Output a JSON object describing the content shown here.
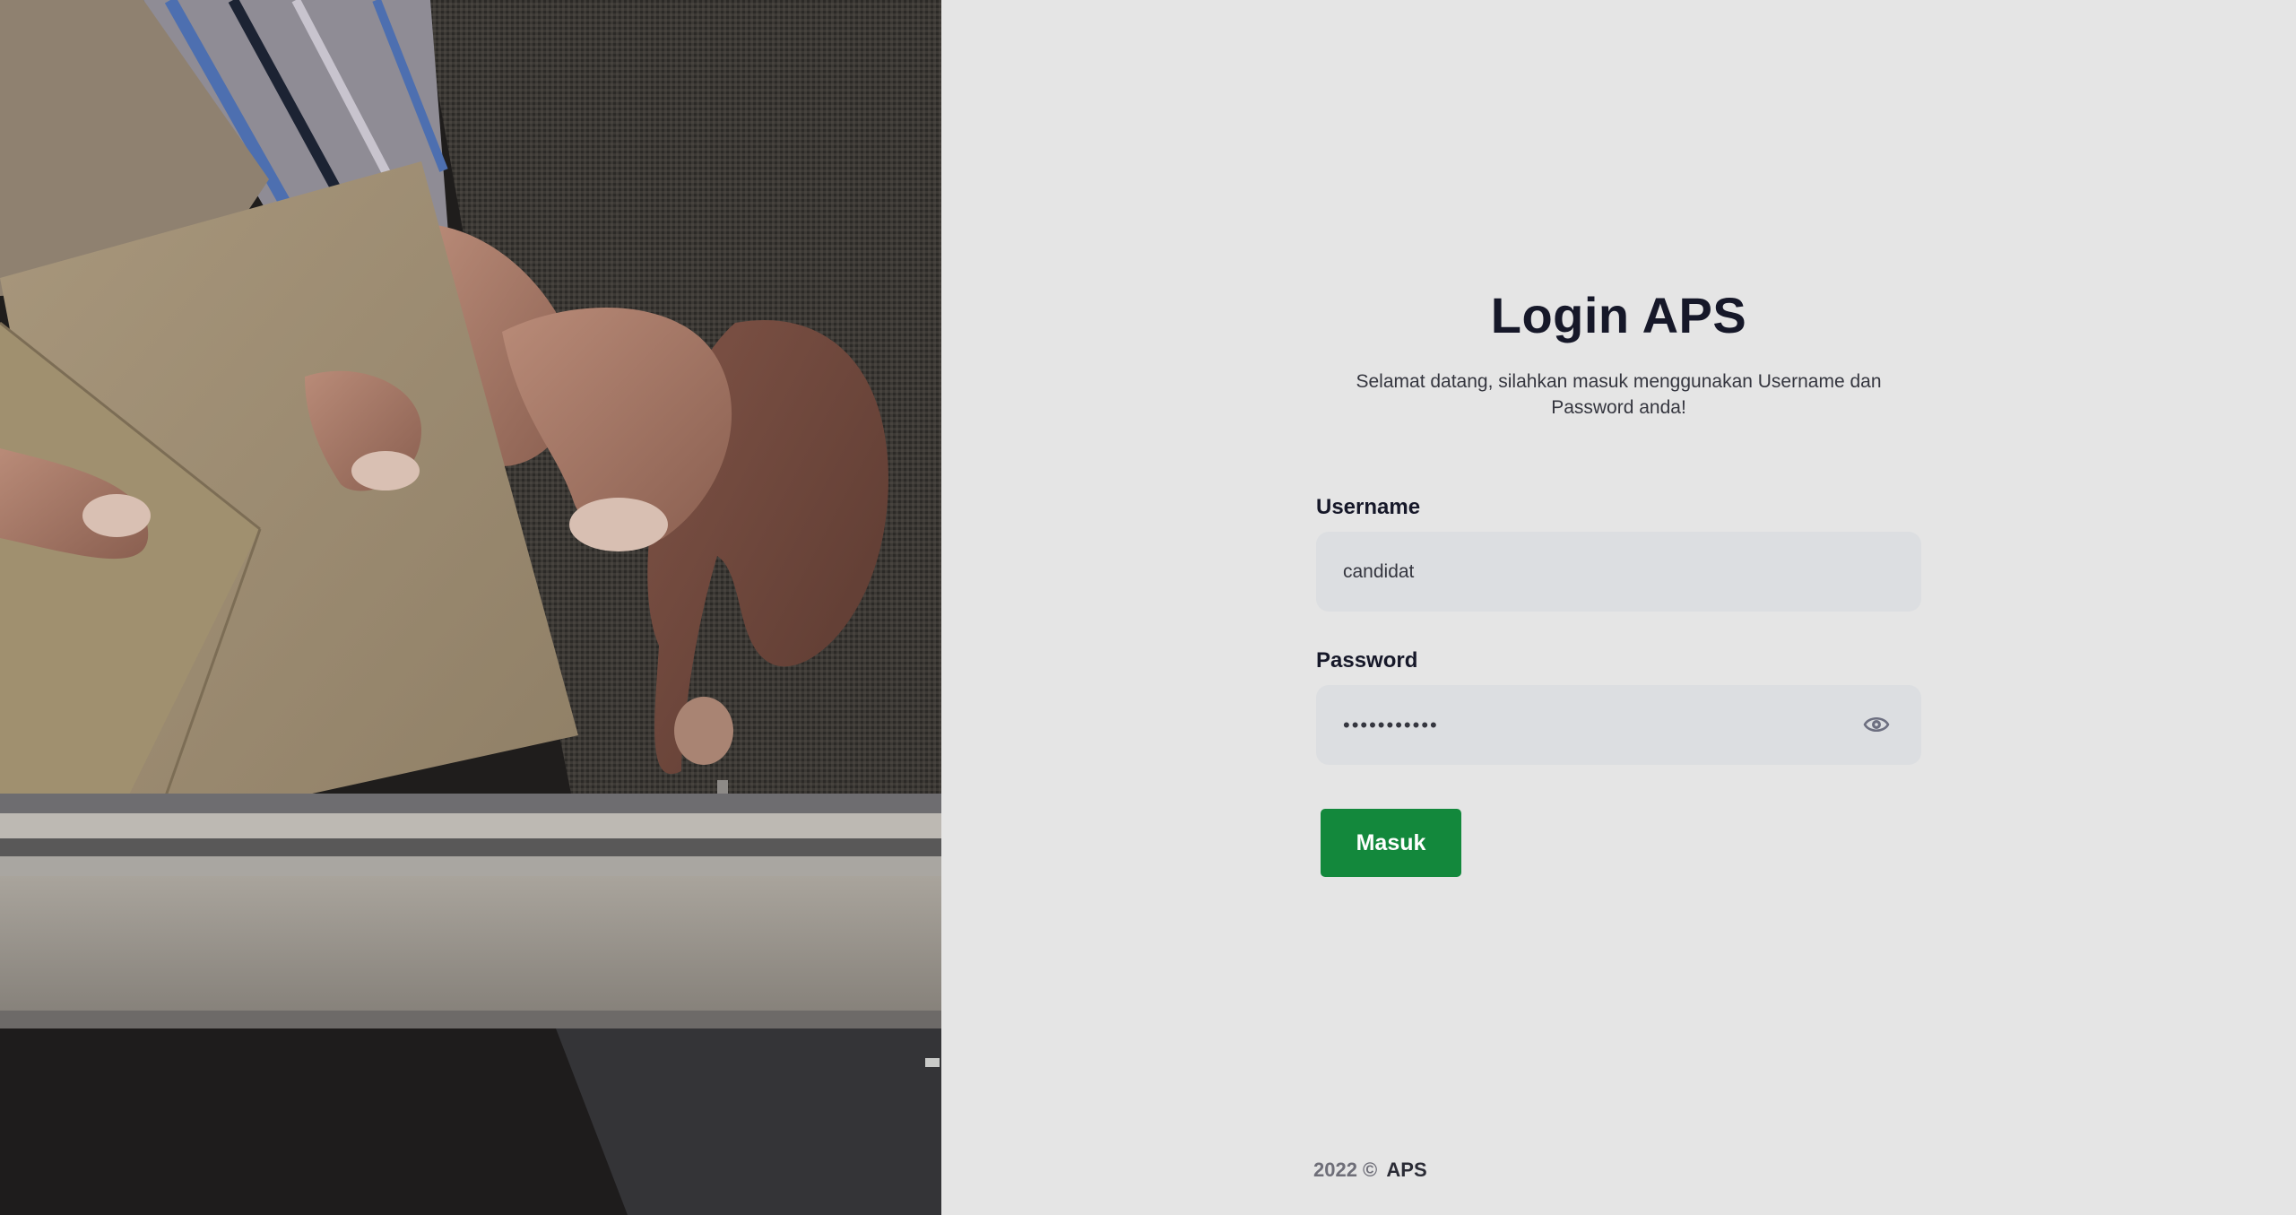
{
  "hero": {
    "image": "ballot-box-envelope-photo"
  },
  "login": {
    "title": "Login APS",
    "subtitle": "Selamat datang, silahkan masuk menggunakan Username dan Password anda!",
    "username_label": "Username",
    "username_value": "candidat",
    "password_label": "Password",
    "password_value": "•••••••••••",
    "show_password_icon": "eye-icon",
    "submit_label": "Masuk"
  },
  "footer": {
    "year_text": "2022 ©",
    "brand": "APS"
  },
  "colors": {
    "accent": "#13883c",
    "background": "#e5e5e5",
    "input_bg": "#dcdee1",
    "title": "#161829"
  }
}
